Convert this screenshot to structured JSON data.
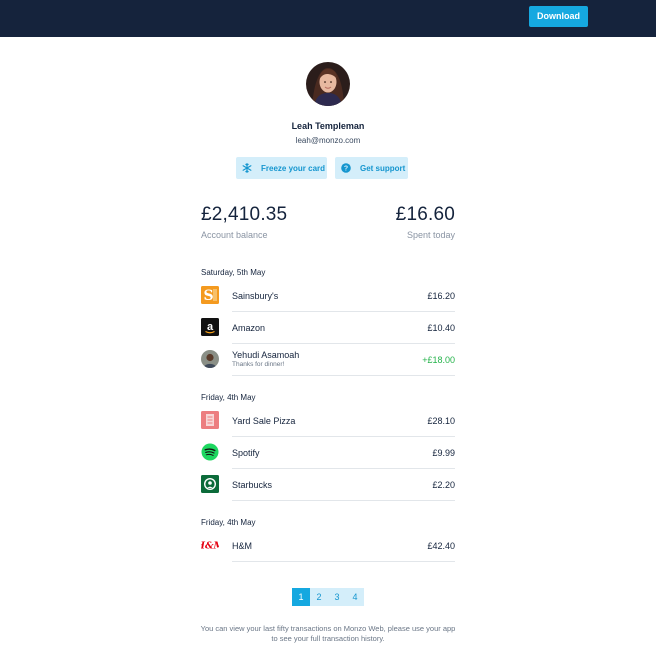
{
  "header": {
    "download_label": "Download",
    "brand_color": "#15233c",
    "accent_color": "#15a8e0"
  },
  "profile": {
    "name": "Leah Templeman",
    "email": "leah@monzo.com",
    "avatar_icon": "avatar-photo"
  },
  "actions": [
    {
      "label": "Freeze your card",
      "icon": "snowflake-icon"
    },
    {
      "label": "Get support",
      "icon": "question-icon"
    }
  ],
  "summary": {
    "balance_value": "£2,410.35",
    "balance_label": "Account balance",
    "spent_value": "£16.60",
    "spent_label": "Spent today"
  },
  "days": [
    {
      "date": "Saturday, 5th May",
      "transactions": [
        {
          "merchant": "Sainsbury's",
          "amount": "£16.20",
          "logo": "sainsburys-logo"
        },
        {
          "merchant": "Amazon",
          "amount": "£10.40",
          "logo": "amazon-logo"
        },
        {
          "merchant": "Yehudi Asamoah",
          "note": "Thanks for dinner!",
          "amount": "+£18.00",
          "logo": "person-avatar",
          "credit": true
        }
      ]
    },
    {
      "date": "Friday, 4th May",
      "transactions": [
        {
          "merchant": "Yard Sale Pizza",
          "amount": "£28.10",
          "logo": "yard-sale-pizza-logo"
        },
        {
          "merchant": "Spotify",
          "amount": "£9.99",
          "logo": "spotify-logo"
        },
        {
          "merchant": "Starbucks",
          "amount": "£2.20",
          "logo": "starbucks-logo"
        }
      ]
    },
    {
      "date": "Friday, 4th May",
      "transactions": [
        {
          "merchant": "H&M",
          "amount": "£42.40",
          "logo": "hm-logo"
        }
      ]
    }
  ],
  "pagination": {
    "pages": [
      "1",
      "2",
      "3",
      "4"
    ],
    "current": "1"
  },
  "footer": {
    "note": "You can view your last fifty transactions on Monzo Web, please use your app to see your full transaction history."
  }
}
